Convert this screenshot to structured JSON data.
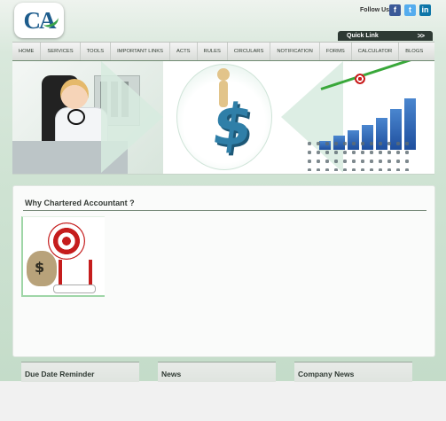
{
  "header": {
    "logo_text": "CA",
    "follow_label": "Follow Us:",
    "social": [
      "f",
      "t",
      "in"
    ],
    "quick_link": "Quick Link",
    "quick_link_arrow": ">>"
  },
  "nav": {
    "items": [
      "HOME",
      "SERVICES",
      "TOOLS",
      "IMPORTANT LINKS",
      "ACTS",
      "RULES",
      "CIRCULARS",
      "NOTIFICATION",
      "FORMS",
      "CALCULATOR",
      "BLOGS"
    ]
  },
  "main": {
    "title": "Why Chartered Accountant ?",
    "bag_symbol": "$"
  },
  "boxes": [
    "Due Date Reminder",
    "News",
    "Company News"
  ],
  "colors": {
    "brand_blue": "#1d5c8c",
    "brand_green": "#3aa34a",
    "nav_accent": "#6f8a72"
  }
}
